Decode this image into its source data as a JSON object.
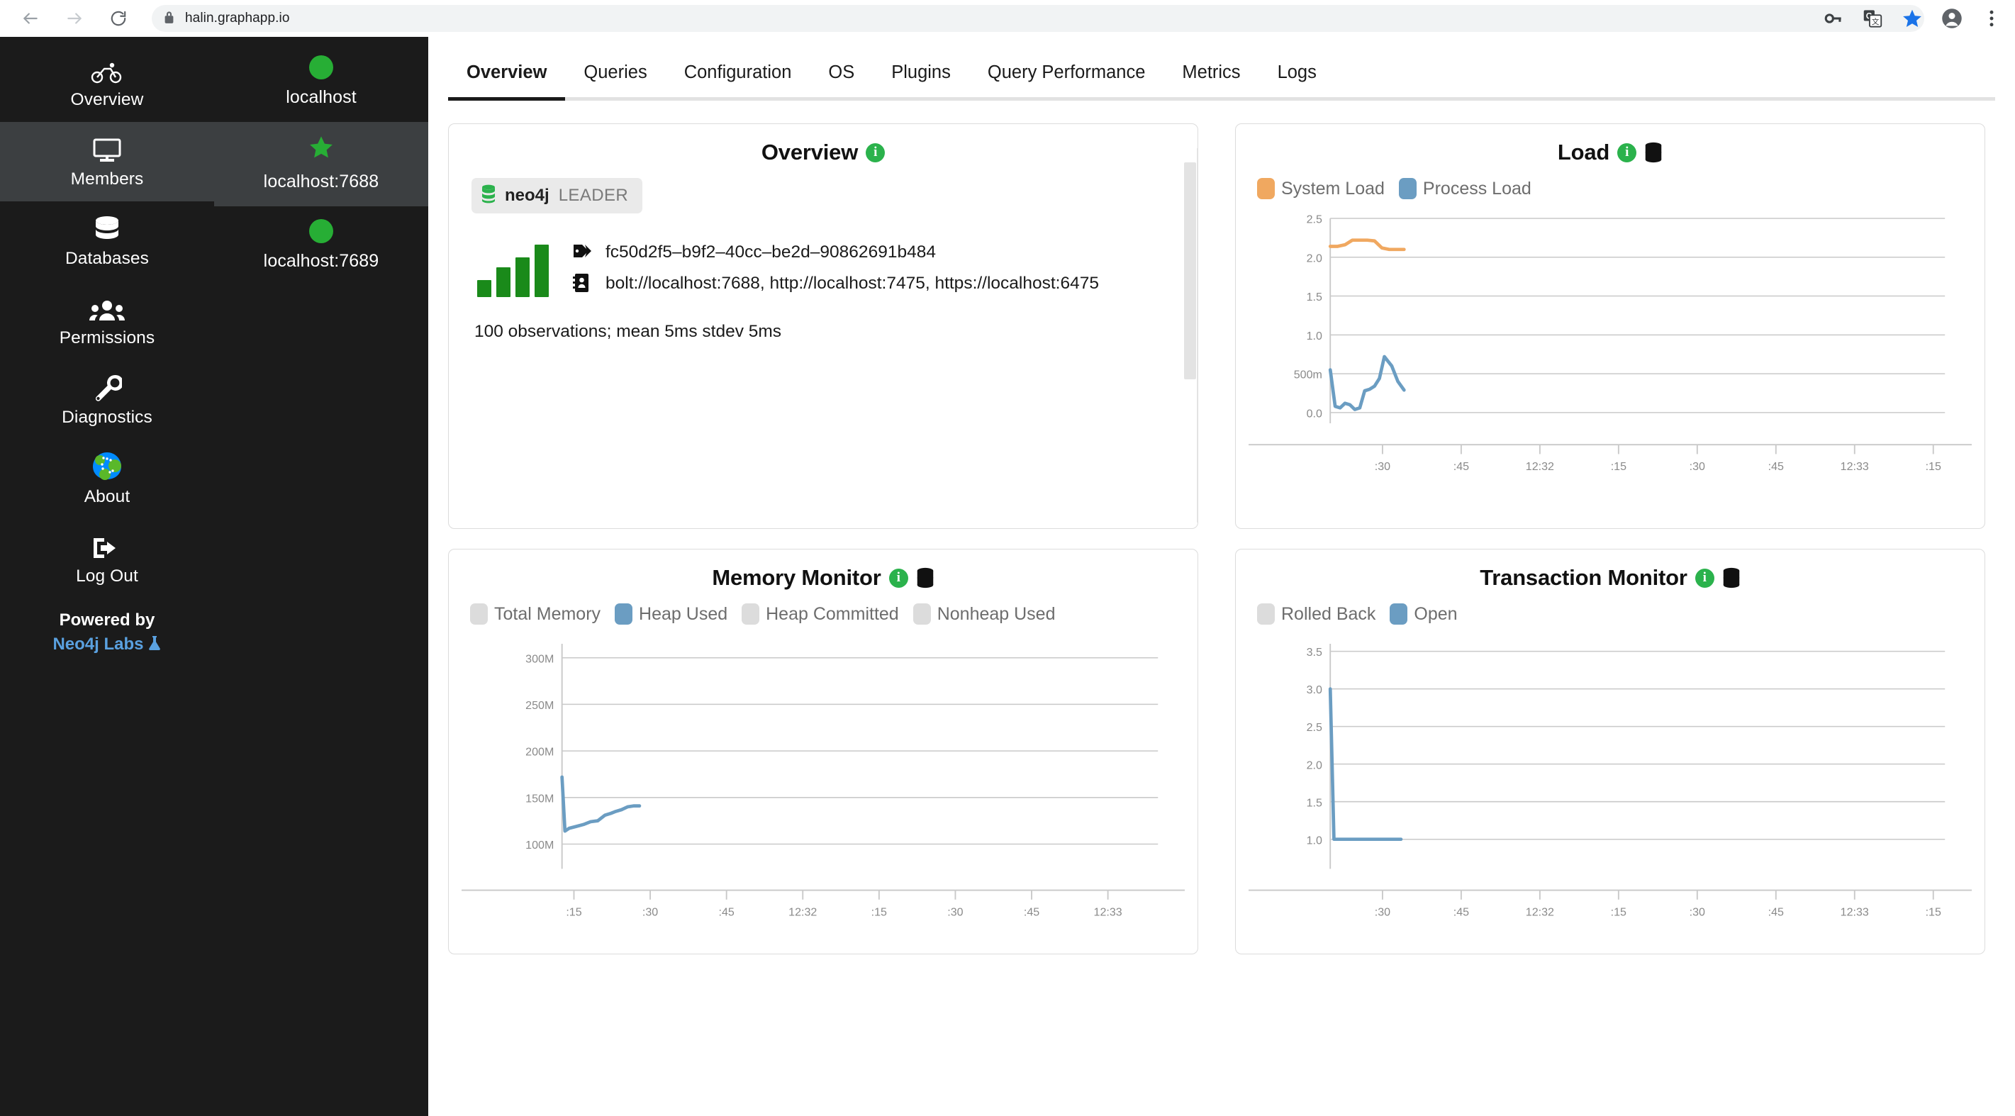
{
  "browser": {
    "url": "halin.graphapp.io",
    "icons": [
      "back-arrow-icon",
      "forward-arrow-icon",
      "reload-icon",
      "lock-icon",
      "key-icon",
      "translate-icon",
      "bookmark-star-icon",
      "profile-avatar-icon",
      "chrome-menu-icon"
    ]
  },
  "sidebar": {
    "items": [
      {
        "label": "Overview",
        "icon": "bicycle-icon",
        "active": false
      },
      {
        "label": "Members",
        "icon": "monitor-icon",
        "active": true
      },
      {
        "label": "Databases",
        "icon": "database-icon",
        "active": false
      },
      {
        "label": "Permissions",
        "icon": "people-icon",
        "active": false
      },
      {
        "label": "Diagnostics",
        "icon": "wrench-icon",
        "active": false
      },
      {
        "label": "About",
        "icon": "neo4j-logo-icon",
        "active": false
      },
      {
        "label": "Log Out",
        "icon": "logout-icon",
        "active": false
      }
    ],
    "powered_by": "Powered by",
    "powered_link": "Neo4j Labs"
  },
  "members": {
    "items": [
      {
        "label": "localhost",
        "icon": "green-dot-icon",
        "active": false
      },
      {
        "label": "localhost:7688",
        "icon": "green-star-icon",
        "active": true
      },
      {
        "label": "localhost:7689",
        "icon": "green-dot-icon",
        "active": false
      }
    ]
  },
  "tabs": [
    {
      "label": "Overview",
      "active": true
    },
    {
      "label": "Queries",
      "active": false
    },
    {
      "label": "Configuration",
      "active": false
    },
    {
      "label": "OS",
      "active": false
    },
    {
      "label": "Plugins",
      "active": false
    },
    {
      "label": "Query Performance",
      "active": false
    },
    {
      "label": "Metrics",
      "active": false
    },
    {
      "label": "Logs",
      "active": false
    }
  ],
  "overview_card": {
    "title": "Overview",
    "db_name": "neo4j",
    "db_role": "LEADER",
    "uuid": "fc50d2f5–b9f2–40cc–be2d–90862691b484",
    "addresses": "bolt://localhost:7688, http://localhost:7475, https://localhost:6475",
    "stats": "100 observations;  mean 5ms stdev 5ms"
  },
  "colors": {
    "accent_green": "#2bb24c",
    "status_green": "#27ae35",
    "bar_green": "#1a8a1a",
    "series_orange": "#f0a860",
    "series_blue": "#6b9dc2",
    "series_gray": "#dcdcdc",
    "sidebar_bg": "#1b1b1b",
    "sidebar_active": "#3c3f41",
    "link_blue": "#5aa1e0"
  },
  "chart_data": [
    {
      "id": "load",
      "type": "line",
      "title": "Load",
      "legend": [
        {
          "name": "System Load",
          "color": "#f0a860",
          "enabled": true
        },
        {
          "name": "Process Load",
          "color": "#6b9dc2",
          "enabled": true
        }
      ],
      "xlabel": "",
      "ylabel": "",
      "xticks": [
        ":30",
        ":45",
        "12:32",
        ":15",
        ":30",
        ":45",
        "12:33",
        ":15"
      ],
      "yticks": [
        "2.5",
        "2.0",
        "1.5",
        "1.0",
        "500m",
        "0.0"
      ],
      "ylim": [
        0,
        2.5
      ],
      "grid": true,
      "series": [
        {
          "name": "System Load",
          "color": "#f0a860",
          "x": [
            0.0,
            0.012,
            0.024,
            0.036,
            0.048,
            0.06,
            0.072,
            0.084,
            0.096,
            0.108,
            0.12
          ],
          "values": [
            2.14,
            2.14,
            2.16,
            2.22,
            2.22,
            2.22,
            2.21,
            2.12,
            2.1,
            2.1,
            2.1
          ]
        },
        {
          "name": "Process Load",
          "color": "#6b9dc2",
          "x": [
            0.0,
            0.008,
            0.016,
            0.024,
            0.032,
            0.04,
            0.048,
            0.056,
            0.064,
            0.072,
            0.08,
            0.088,
            0.1,
            0.11,
            0.12
          ],
          "values": [
            0.55,
            0.08,
            0.06,
            0.12,
            0.1,
            0.04,
            0.06,
            0.28,
            0.3,
            0.34,
            0.44,
            0.72,
            0.6,
            0.4,
            0.29
          ]
        }
      ]
    },
    {
      "id": "memory",
      "type": "line",
      "title": "Memory Monitor",
      "legend": [
        {
          "name": "Total Memory",
          "color": "#dcdcdc",
          "enabled": false
        },
        {
          "name": "Heap Used",
          "color": "#6b9dc2",
          "enabled": true
        },
        {
          "name": "Heap Committed",
          "color": "#dcdcdc",
          "enabled": false
        },
        {
          "name": "Nonheap Used",
          "color": "#dcdcdc",
          "enabled": false
        }
      ],
      "xlabel": "",
      "ylabel": "",
      "xticks": [
        ":15",
        ":30",
        ":45",
        "12:32",
        ":15",
        ":30",
        ":45",
        "12:33"
      ],
      "yticks": [
        "300M",
        "250M",
        "200M",
        "150M",
        "100M"
      ],
      "ylim": [
        85000000,
        315000000
      ],
      "grid": true,
      "series": [
        {
          "name": "Heap Used",
          "color": "#6b9dc2",
          "x": [
            0.0,
            0.005,
            0.012,
            0.024,
            0.036,
            0.048,
            0.06,
            0.072,
            0.082,
            0.09,
            0.1,
            0.11,
            0.12,
            0.13
          ],
          "values": [
            172000000,
            114000000,
            117000000,
            119000000,
            121000000,
            124000000,
            125000000,
            131000000,
            133000000,
            135000000,
            137000000,
            140000000,
            141000000,
            141000000
          ]
        }
      ]
    },
    {
      "id": "transactions",
      "type": "line",
      "title": "Transaction Monitor",
      "legend": [
        {
          "name": "Rolled Back",
          "color": "#dcdcdc",
          "enabled": false
        },
        {
          "name": "Open",
          "color": "#6b9dc2",
          "enabled": true
        }
      ],
      "xlabel": "",
      "ylabel": "",
      "xticks": [
        ":30",
        ":45",
        "12:32",
        ":15",
        ":30",
        ":45",
        "12:33",
        ":15"
      ],
      "yticks": [
        "3.5",
        "3.0",
        "2.5",
        "2.0",
        "1.5",
        "1.0"
      ],
      "ylim": [
        0.75,
        3.6
      ],
      "grid": true,
      "series": [
        {
          "name": "Open",
          "color": "#6b9dc2",
          "x": [
            0.0,
            0.006,
            0.012,
            0.03,
            0.06,
            0.09,
            0.115
          ],
          "values": [
            3.0,
            1.0,
            1.0,
            1.0,
            1.0,
            1.0,
            1.0
          ]
        }
      ]
    },
    {
      "id": "overview-sparkline",
      "type": "bar",
      "title": "Response time sparkline",
      "categories": [
        "1",
        "2",
        "3",
        "4"
      ],
      "values": [
        30,
        52,
        70,
        92
      ],
      "color": "#1a8a1a"
    }
  ]
}
